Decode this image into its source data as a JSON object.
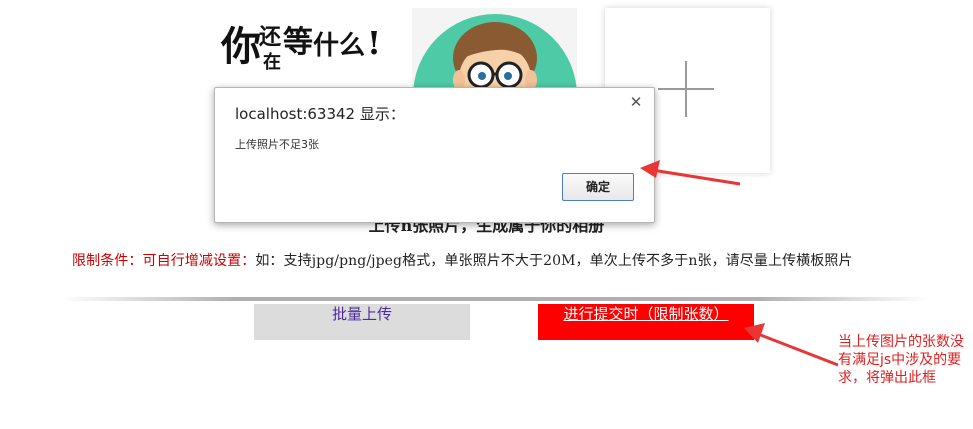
{
  "thumbnails": [
    {
      "name": "thumbnail-meme",
      "calligraphy": "你还在等什么！"
    },
    {
      "name": "thumbnail-avatar"
    },
    {
      "name": "thumbnail-add",
      "icon": "plus-icon"
    }
  ],
  "section": {
    "title": "上传n张照片，生成属于你的相册",
    "limit_label": "限制条件：可自行增减设置：",
    "limit_text": "如：支持jpg/png/jpeg格式，单张照片不大于20M，单次上传不多于n张，请尽量上传横板照片"
  },
  "buttons": {
    "batch_upload": "批量上传",
    "submit": "进行提交时（限制张数）"
  },
  "annotation": "当上传图片的张数没有满足js中涉及的要求，将弹出此框",
  "dialog": {
    "title": "localhost:63342 显示：",
    "message": "上传照片不足3张",
    "ok_label": "确定",
    "close_icon": "close-icon"
  },
  "colors": {
    "accent_red": "#ff0000",
    "annotation_red": "#e02020",
    "avatar_bg": "#4ecba6"
  }
}
